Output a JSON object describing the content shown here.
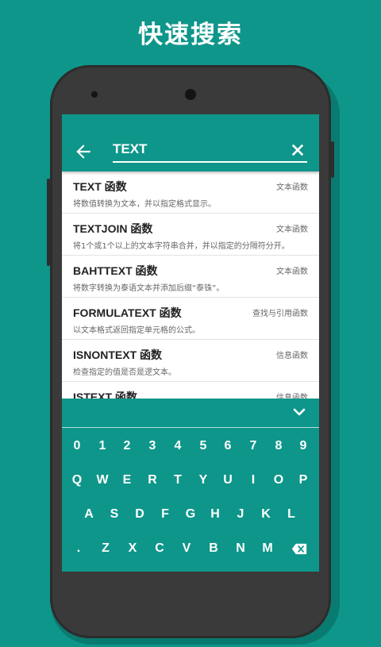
{
  "headline": "快速搜索",
  "search": {
    "value": "TEXT"
  },
  "results": [
    {
      "title": "TEXT 函数",
      "category": "文本函数",
      "desc": "将数值转换为文本，并以指定格式显示。"
    },
    {
      "title": "TEXTJOIN 函数",
      "category": "文本函数",
      "desc": "将1个或1个以上的文本字符串合并，并以指定的分隔符分开。"
    },
    {
      "title": "BAHTTEXT 函数",
      "category": "文本函数",
      "desc": "将数字转换为泰语文本并添加后缀“泰铢”。"
    },
    {
      "title": "FORMULATEXT 函数",
      "category": "查找与引用函数",
      "desc": "以文本格式返回指定单元格的公式。"
    },
    {
      "title": "ISNONTEXT 函数",
      "category": "信息函数",
      "desc": "检查指定的值是否是逻文本。"
    },
    {
      "title": "ISTEXT 函数",
      "category": "信息函数",
      "desc": ""
    }
  ],
  "keyboard": {
    "row1": [
      "0",
      "1",
      "2",
      "3",
      "4",
      "5",
      "6",
      "7",
      "8",
      "9"
    ],
    "row2": [
      "Q",
      "W",
      "E",
      "R",
      "T",
      "Y",
      "U",
      "I",
      "O",
      "P"
    ],
    "row3": [
      "A",
      "S",
      "D",
      "F",
      "G",
      "H",
      "J",
      "K",
      "L"
    ],
    "row4": [
      ".",
      "Z",
      "X",
      "C",
      "V",
      "B",
      "N",
      "M"
    ]
  },
  "colors": {
    "accent": "#0e968a",
    "phone": "#3a3a3a"
  },
  "icons": {
    "back": "arrow-left-icon",
    "clear": "close-icon",
    "collapse": "chevron-down-icon",
    "backspace": "backspace-icon"
  }
}
